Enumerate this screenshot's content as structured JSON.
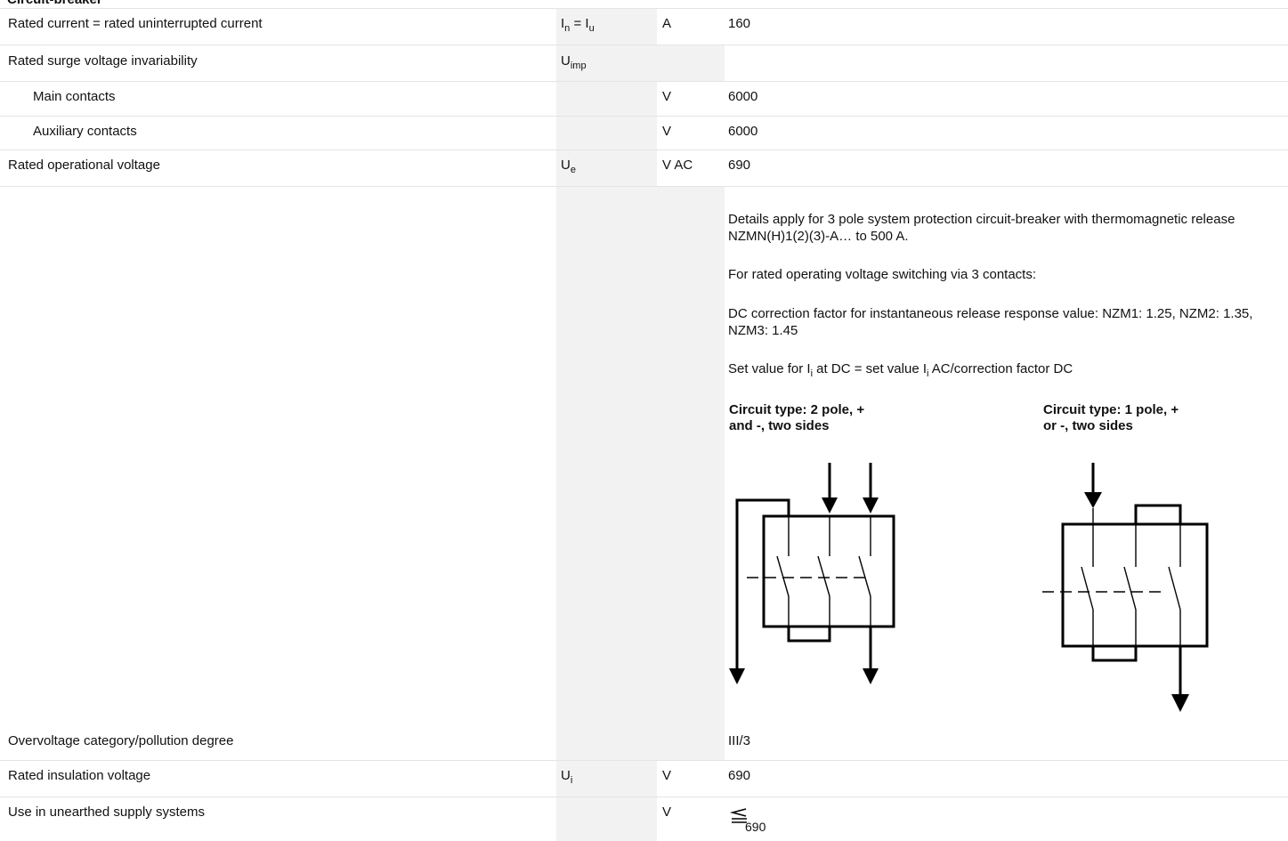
{
  "section_heading": "Circuit-breaker",
  "rows": {
    "rated_current": {
      "description": "Rated current = rated uninterrupted current",
      "symbol_main": "I",
      "symbol_sub": "n",
      "symbol_eq": " = I",
      "symbol_sub2": "u",
      "unit": "A",
      "value": "160"
    },
    "surge_voltage": {
      "description": "Rated surge voltage invariability",
      "symbol_main": "U",
      "symbol_sub": "imp"
    },
    "main_contacts": {
      "description": "Main contacts",
      "unit": "V",
      "value": "6000"
    },
    "aux_contacts": {
      "description": "Auxiliary contacts",
      "unit": "V",
      "value": "6000"
    },
    "operational_voltage": {
      "description": "Rated operational voltage",
      "symbol_main": "U",
      "symbol_sub": "e",
      "unit": "V AC",
      "value": "690"
    },
    "overvoltage": {
      "description": "Overvoltage category/pollution degree",
      "value": "III/3"
    },
    "insulation_voltage": {
      "description": "Rated insulation voltage",
      "symbol_main": "U",
      "symbol_sub": "i",
      "unit": "V",
      "value": "690"
    },
    "unearthed": {
      "description": "Use in unearthed supply systems",
      "unit": "V",
      "value": "690",
      "value_icon": "less-than-or-equal-icon"
    }
  },
  "dc_notes": {
    "details": "Details apply for 3 pole system protection circuit-breaker with thermomagnetic release NZMN(H)1(2)(3)-A… to 500 A.",
    "switching": "For rated operating voltage switching via 3 contacts:",
    "correction": "DC correction factor for instantaneous release response value: NZM1: 1.25, NZM2: 1.35, NZM3: 1.45",
    "set_value_a": "Set value for I",
    "set_value_sub1": "i",
    "set_value_b": " at DC = set value I",
    "set_value_sub2": "i",
    "set_value_c": " AC/correction factor DC"
  },
  "circuits": {
    "two_pole": {
      "title_line1": "Circuit type: 2 pole, +",
      "title_line2": "and -, two sides"
    },
    "one_pole": {
      "title_line1": "Circuit type: 1 pole, +",
      "title_line2": "or -, two sides"
    }
  },
  "colors": {
    "shade": "#f2f2f2",
    "divider": "#e4e4e4",
    "text": "#111111"
  }
}
